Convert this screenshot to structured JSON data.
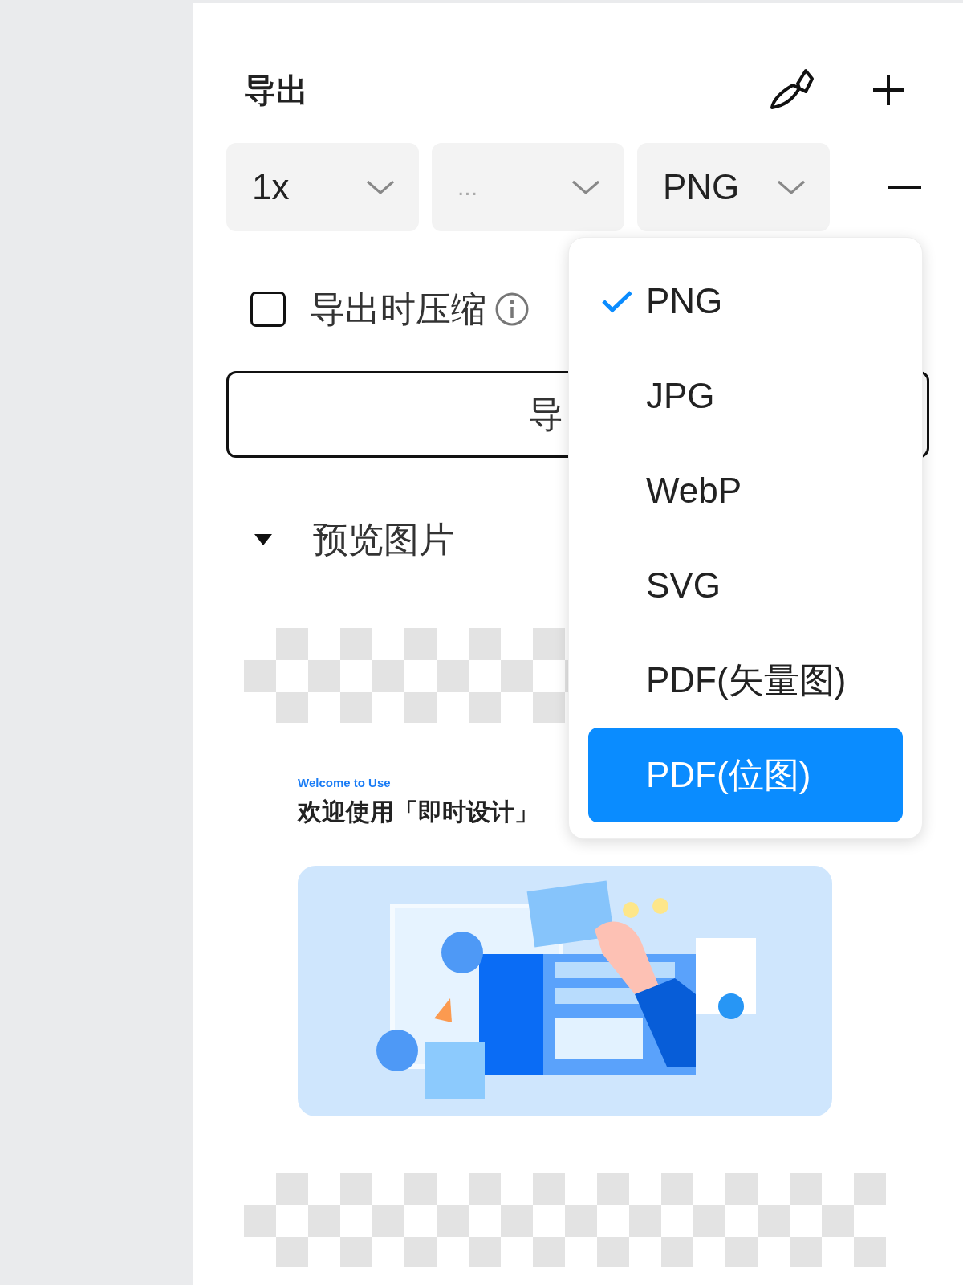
{
  "panel": {
    "title": "导出"
  },
  "selects": [
    {
      "kind": "value",
      "text": "1x"
    },
    {
      "kind": "placeholder",
      "text": "..."
    },
    {
      "kind": "value",
      "text": "PNG"
    }
  ],
  "compress": {
    "label": "导出时压缩",
    "checked": false
  },
  "export_button": {
    "label": "导"
  },
  "format_menu": {
    "items": [
      {
        "label": "PNG",
        "selected": true,
        "highlighted": false
      },
      {
        "label": "JPG",
        "selected": false,
        "highlighted": false
      },
      {
        "label": "WebP",
        "selected": false,
        "highlighted": false
      },
      {
        "label": "SVG",
        "selected": false,
        "highlighted": false
      },
      {
        "label": "PDF(矢量图)",
        "selected": false,
        "highlighted": false
      },
      {
        "label": "PDF(位图)",
        "selected": false,
        "highlighted": true
      }
    ]
  },
  "preview": {
    "title": "预览图片",
    "expanded": true,
    "subtitle": "Welcome to Use",
    "heading": "欢迎使用「即时设计」"
  }
}
